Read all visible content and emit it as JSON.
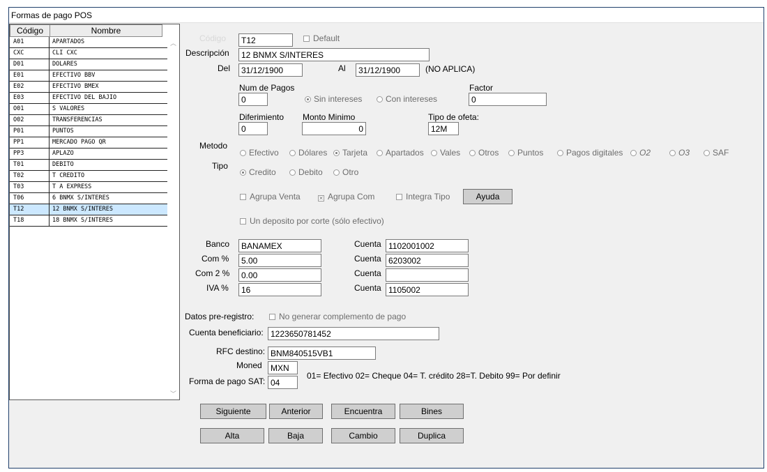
{
  "window": {
    "title": "Formas de pago POS"
  },
  "list": {
    "headers": {
      "code": "Código",
      "name": "Nombre"
    },
    "rows": [
      {
        "code": "A01",
        "name": "APARTADOS"
      },
      {
        "code": "CXC",
        "name": "CLI CXC"
      },
      {
        "code": "D01",
        "name": "DOLARES"
      },
      {
        "code": "E01",
        "name": "EFECTIVO BBV"
      },
      {
        "code": "E02",
        "name": "EFECTIVO BMEX"
      },
      {
        "code": "E03",
        "name": "EFECTIVO DEL BAJIO"
      },
      {
        "code": "O01",
        "name": "S VALORES"
      },
      {
        "code": "O02",
        "name": "TRANSFERENCIAS"
      },
      {
        "code": "P01",
        "name": "PUNTOS"
      },
      {
        "code": "PP1",
        "name": "MERCADO PAGO QR"
      },
      {
        "code": "PP3",
        "name": "APLAZO"
      },
      {
        "code": "T01",
        "name": "DEBITO"
      },
      {
        "code": "T02",
        "name": "T CREDITO"
      },
      {
        "code": "T03",
        "name": "T A EXPRESS"
      },
      {
        "code": "T06",
        "name": "6 BNMX S/INTERES"
      },
      {
        "code": "T12",
        "name": "12 BNMX S/INTERES"
      },
      {
        "code": "T18",
        "name": "18 BNMX S/INTERES"
      }
    ],
    "selected_code": "T12"
  },
  "form": {
    "codigo_label": "Código",
    "codigo_value": "T12",
    "default_label": "Default",
    "descripcion_label": "Descripción",
    "descripcion_value": "12 BNMX S/INTERES",
    "del_label": "Del",
    "del_value": "31/12/1900",
    "al_label": "Al",
    "al_value": "31/12/1900",
    "no_aplica": "(NO APLICA)",
    "num_pagos_label": "Num de Pagos",
    "num_pagos_value": "0",
    "sin_intereses": "Sin intereses",
    "con_intereses": "Con intereses",
    "factor_label": "Factor",
    "factor_value": "0",
    "diferimiento_label": "Diferimiento",
    "diferimiento_value": "0",
    "monto_minimo_label": "Monto Minimo",
    "monto_minimo_value": "0",
    "tipo_ofeta_label": "Tipo de ofeta:",
    "tipo_ofeta_value": "12M",
    "metodo_label": "Metodo",
    "metodo_options": {
      "efectivo": "Efectivo",
      "dolares": "Dólares",
      "tarjeta": "Tarjeta",
      "apartados": "Apartados",
      "vales": "Vales",
      "otros": "Otros",
      "puntos": "Puntos",
      "pagos_digitales": "Pagos digitales",
      "o2": "O2",
      "o3": "O3",
      "saf": "SAF"
    },
    "metodo_selected": "Tarjeta",
    "tipo_label": "Tipo",
    "tipo_options": {
      "credito": "Credito",
      "debito": "Debito",
      "otro": "Otro"
    },
    "tipo_selected": "Credito",
    "agrupa_venta": "Agrupa Venta",
    "agrupa_com": "Agrupa Com",
    "integra_tipo": "Integra Tipo",
    "ayuda": "Ayuda",
    "un_deposito": "Un deposito por corte (sólo efectivo)",
    "banco_label": "Banco",
    "banco_value": "BANAMEX",
    "com_label": "Com %",
    "com_value": "5.00",
    "com2_label": "Com 2 %",
    "com2_value": "0.00",
    "iva_label": "IVA %",
    "iva_value": "16",
    "cuenta_label": "Cuenta",
    "cuenta1": "1102001002",
    "cuenta2": "6203002",
    "cuenta3": "",
    "cuenta4": "1105002",
    "datos_preregistro_label": "Datos pre-registro:",
    "no_generar": "No generar complemento de pago",
    "cuenta_beneficiario_label": "Cuenta beneficiario:",
    "cuenta_beneficiario_value": "1223650781452",
    "rfc_destino_label": "RFC destino:",
    "rfc_destino_value": "BNM840515VB1",
    "moned_label": "Moned",
    "moned_value": "MXN",
    "forma_pago_sat_label": "Forma de pago SAT:",
    "forma_pago_sat_value": "04",
    "sat_legend": "01= Efectivo  02= Cheque  04= T. crédito  28=T. Debito  99= Por definir"
  },
  "buttons": {
    "siguiente": "Siguiente",
    "anterior": "Anterior",
    "encuentra": "Encuentra",
    "bines": "Bines",
    "alta": "Alta",
    "baja": "Baja",
    "cambio": "Cambio",
    "duplica": "Duplica"
  }
}
